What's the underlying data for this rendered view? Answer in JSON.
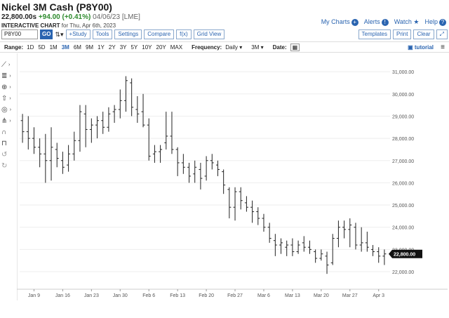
{
  "header": {
    "title": "Nickel 3M Cash (P8Y00)",
    "last": "22,800.00s",
    "change": "+94.00 (+0.41%)",
    "date": "04/06/23 [LME]",
    "subtitle_bold": "INTERACTIVE CHART",
    "subtitle_rest": "for Thu, Apr 6th, 2023"
  },
  "toplinks": {
    "my_charts": "My Charts",
    "alerts": "Alerts",
    "watch": "Watch",
    "help": "Help"
  },
  "toolbar": {
    "symbol_value": "P8Y00",
    "go": "GO",
    "study": "+Study",
    "tools": "Tools",
    "settings": "Settings",
    "compare": "Compare",
    "fx": "f(x)",
    "grid_view": "Grid View",
    "templates": "Templates",
    "print": "Print",
    "clear": "Clear"
  },
  "rangebar": {
    "range_label": "Range:",
    "ranges": [
      "1D",
      "5D",
      "1M",
      "3M",
      "6M",
      "9M",
      "1Y",
      "2Y",
      "3Y",
      "5Y",
      "10Y",
      "20Y",
      "MAX"
    ],
    "active_range": "3M",
    "frequency_label": "Frequency:",
    "frequency": "Daily",
    "period": "3M",
    "date_label": "Date:",
    "tutorial": "tutorial"
  },
  "chart_data": {
    "type": "ohlc",
    "last_price_label": "22,800.00",
    "y_ticks": [
      31000,
      30000,
      29000,
      28000,
      27000,
      26000,
      25000,
      24000,
      23000,
      22000
    ],
    "y_tick_labels": [
      "31,000.00",
      "30,000.00",
      "29,000.00",
      "28,000.00",
      "27,000.00",
      "26,000.00",
      "25,000.00",
      "24,000.00",
      "23,000.00",
      "22,000.00"
    ],
    "ylim": [
      21400,
      31700
    ],
    "x_tick_labels": [
      "Jan 9",
      "Jan 16",
      "Jan 23",
      "Jan 30",
      "Feb 6",
      "Feb 13",
      "Feb 20",
      "Feb 27",
      "Mar 6",
      "Mar 13",
      "Mar 20",
      "Mar 27",
      "Apr 3"
    ],
    "x_tick_index": [
      2,
      7,
      12,
      17,
      22,
      27,
      32,
      37,
      42,
      47,
      52,
      57,
      62
    ],
    "bars": [
      [
        28800,
        29100,
        27800,
        28300
      ],
      [
        28300,
        29000,
        27500,
        28000
      ],
      [
        28000,
        28500,
        27300,
        27600
      ],
      [
        27600,
        28000,
        26700,
        27300
      ],
      [
        27300,
        28200,
        26000,
        27000
      ],
      [
        27000,
        28500,
        26100,
        27600
      ],
      [
        27500,
        27800,
        26700,
        27100
      ],
      [
        27000,
        27400,
        26400,
        26700
      ],
      [
        26800,
        27700,
        26500,
        27300
      ],
      [
        27300,
        28300,
        27000,
        27900
      ],
      [
        27900,
        29500,
        27400,
        29200
      ],
      [
        29100,
        29500,
        27600,
        28400
      ],
      [
        28400,
        28900,
        27800,
        28600
      ],
      [
        28600,
        29000,
        28000,
        28800
      ],
      [
        28800,
        29200,
        28200,
        28500
      ],
      [
        28500,
        29400,
        28300,
        29100
      ],
      [
        29200,
        29500,
        28700,
        29300
      ],
      [
        29300,
        30200,
        28900,
        29700
      ],
      [
        29700,
        30800,
        29200,
        30600
      ],
      [
        30500,
        30700,
        29000,
        29400
      ],
      [
        29300,
        29900,
        28700,
        29100
      ],
      [
        29200,
        30000,
        28500,
        28600
      ],
      [
        28600,
        28900,
        27000,
        27200
      ],
      [
        27300,
        27700,
        26900,
        27400
      ],
      [
        27400,
        27700,
        26900,
        27500
      ],
      [
        27800,
        29200,
        27500,
        28100
      ],
      [
        28100,
        29200,
        27300,
        27500
      ],
      [
        27500,
        27600,
        26300,
        26900
      ],
      [
        26900,
        27300,
        26400,
        26700
      ],
      [
        26700,
        26900,
        26000,
        26300
      ],
      [
        26400,
        27000,
        26000,
        26700
      ],
      [
        26600,
        26900,
        25700,
        26200
      ],
      [
        26300,
        27200,
        26100,
        27000
      ],
      [
        27000,
        27300,
        26600,
        26900
      ],
      [
        26800,
        27000,
        26300,
        26600
      ],
      [
        26500,
        26600,
        25500,
        25900
      ],
      [
        25700,
        25800,
        24400,
        24900
      ],
      [
        24900,
        25800,
        24300,
        25600
      ],
      [
        25600,
        25800,
        24800,
        25200
      ],
      [
        25100,
        25400,
        24700,
        24900
      ],
      [
        24900,
        25200,
        24200,
        24700
      ],
      [
        24700,
        24900,
        24100,
        24400
      ],
      [
        24400,
        24600,
        23800,
        24000
      ],
      [
        24000,
        24200,
        23300,
        23500
      ],
      [
        23400,
        23700,
        22700,
        23200
      ],
      [
        23200,
        23500,
        22800,
        23300
      ],
      [
        23100,
        23400,
        22700,
        23200
      ],
      [
        23200,
        23500,
        22700,
        22900
      ],
      [
        22900,
        23400,
        22800,
        23200
      ],
      [
        23300,
        23600,
        22900,
        23100
      ],
      [
        23100,
        23400,
        22800,
        23000
      ],
      [
        22900,
        23000,
        22400,
        22600
      ],
      [
        22600,
        23000,
        22500,
        22800
      ],
      [
        22700,
        22900,
        21900,
        22300
      ],
      [
        22400,
        23700,
        22300,
        23500
      ],
      [
        23500,
        24300,
        23100,
        24000
      ],
      [
        24000,
        24300,
        23500,
        23900
      ],
      [
        23900,
        24400,
        23100,
        24100
      ],
      [
        24000,
        24200,
        23000,
        23200
      ],
      [
        23200,
        24000,
        22900,
        23300
      ],
      [
        23300,
        23800,
        22900,
        23100
      ],
      [
        23000,
        23200,
        22700,
        22900
      ],
      [
        22900,
        23100,
        22400,
        22700
      ],
      [
        22700,
        23000,
        22300,
        22800
      ]
    ]
  },
  "tool_icons": [
    "line-tool-icon",
    "fib-tool-icon",
    "crosshair-tool-icon",
    "arrow-tool-icon",
    "label-tool-icon",
    "pitchfork-tool-icon",
    "magnet-icon",
    "lock-icon",
    "undo-icon",
    "redo-icon"
  ]
}
